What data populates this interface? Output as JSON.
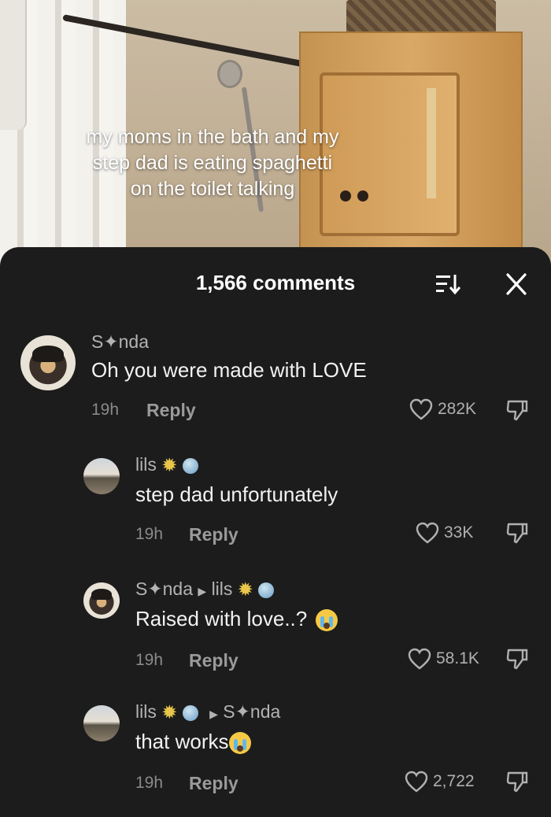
{
  "video": {
    "caption_lines": [
      "my moms in the bath and my",
      "step dad is eating spaghetti",
      "on the toilet talking"
    ]
  },
  "sheet": {
    "comment_count": "1,566 comments",
    "sort_icon": "sort-icon",
    "close_icon": "close-icon"
  },
  "comments": [
    {
      "username": "S✦nda",
      "text": "Oh you were made with LOVE",
      "time": "19h",
      "reply_label": "Reply",
      "likes": "282K"
    },
    {
      "username": "lils",
      "username_emojis": [
        "sun-emoji",
        "globe-emoji"
      ],
      "text": "step dad unfortunately",
      "time": "19h",
      "reply_label": "Reply",
      "likes": "33K"
    },
    {
      "username": "S✦nda",
      "reply_to": "lils",
      "text": "Raised with love..?",
      "text_emoji": "crying-emoji",
      "time": "19h",
      "reply_label": "Reply",
      "likes": "58.1K"
    },
    {
      "username": "lils",
      "reply_to": "S✦nda",
      "text": "that works",
      "text_emoji": "crying-emoji",
      "time": "19h",
      "reply_label": "Reply",
      "likes": "2,722"
    }
  ],
  "colors": {
    "sheet_background": "#1c1c1c",
    "primary_text": "#f2f2f2",
    "secondary_text": "#8a8a8a"
  }
}
